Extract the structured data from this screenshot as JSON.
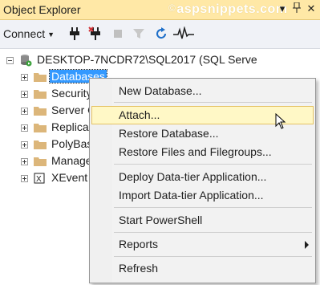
{
  "window": {
    "title": "Object Explorer",
    "watermark": "aspsnippets.com",
    "watermark_symbol": "©"
  },
  "toolbar": {
    "connect_label": "Connect",
    "icons": [
      "connect-plug-icon",
      "disconnect-icon",
      "stop-icon",
      "filter-icon",
      "refresh-icon",
      "activity-monitor-icon"
    ]
  },
  "tree": {
    "server": "DESKTOP-7NCDR72\\SQL2017 (SQL Serve",
    "items": [
      {
        "label": "Databases",
        "selected": true
      },
      {
        "label": "Security"
      },
      {
        "label": "Server O"
      },
      {
        "label": "Replica"
      },
      {
        "label": "PolyBas"
      },
      {
        "label": "Manage"
      },
      {
        "label": "XEvent"
      }
    ]
  },
  "context_menu": {
    "items": [
      {
        "label": "New Database..."
      },
      {
        "label": "Attach...",
        "highlighted": true
      },
      {
        "label": "Restore Database..."
      },
      {
        "label": "Restore Files and Filegroups..."
      },
      {
        "label": "Deploy Data-tier Application..."
      },
      {
        "label": "Import Data-tier Application..."
      },
      {
        "label": "Start PowerShell"
      },
      {
        "label": "Reports",
        "submenu": true
      },
      {
        "label": "Refresh"
      }
    ]
  },
  "colors": {
    "title_bg": "#ffe8a6",
    "selection": "#3399ff",
    "menu_highlight": "#fff8c6",
    "folder": "#dcb67a"
  }
}
